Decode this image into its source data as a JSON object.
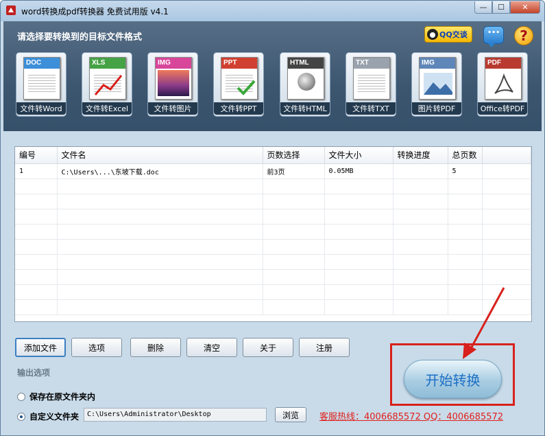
{
  "window": {
    "title": "word转换成pdf转换器 免费试用版 v4.1",
    "min_glyph": "—",
    "max_glyph": "☐",
    "close_glyph": "✕"
  },
  "header": {
    "prompt": "请选择要转换到的目标文件格式",
    "qq_label": "QQ交谈",
    "help_glyph": "?"
  },
  "formats": [
    {
      "tag": "DOC",
      "label": "文件转Word",
      "color": "#3c8fd8"
    },
    {
      "tag": "XLS",
      "label": "文件转Excel",
      "color": "#45a245"
    },
    {
      "tag": "IMG",
      "label": "文件转图片",
      "color": "#d8469a"
    },
    {
      "tag": "PPT",
      "label": "文件转PPT",
      "color": "#d04030"
    },
    {
      "tag": "HTML",
      "label": "文件转HTML",
      "color": "#444444"
    },
    {
      "tag": "TXT",
      "label": "文件转TXT",
      "color": "#9aa3ad"
    },
    {
      "tag": "IMG",
      "label": "图片转PDF",
      "color": "#5e86b8"
    },
    {
      "tag": "PDF",
      "label": "Office转PDF",
      "color": "#b83a30"
    }
  ],
  "table": {
    "columns": [
      "编号",
      "文件名",
      "页数选择",
      "文件大小",
      "转换进度",
      "总页数"
    ],
    "rows": [
      [
        "1",
        "C:\\Users\\...\\东坡下载.doc",
        "前3页",
        "0.05MB",
        "",
        "5"
      ]
    ]
  },
  "actions": {
    "add": "添加文件",
    "options": "选项",
    "delete": "删除",
    "clear": "清空",
    "about": "关于",
    "register": "注册"
  },
  "output": {
    "section_label": "输出选项",
    "opt_original": "保存在原文件夹内",
    "opt_custom": "自定义文件夹",
    "path": "C:\\Users\\Administrator\\Desktop",
    "browse": "浏览",
    "hotline": "客服热线：4006685572 QQ：4006685572"
  },
  "start": {
    "label": "开始转换"
  }
}
